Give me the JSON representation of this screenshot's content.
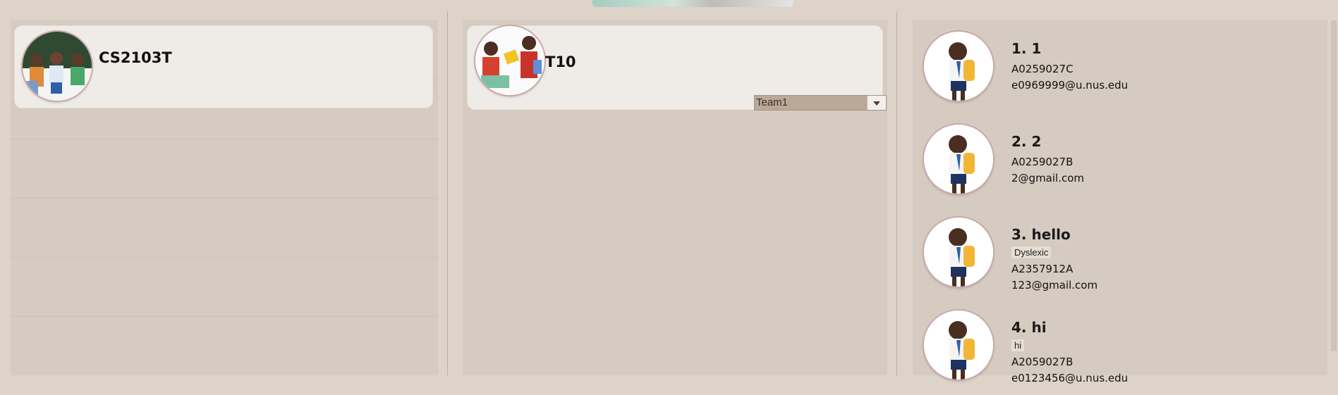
{
  "modules": {
    "items": [
      {
        "code": "CS2103T"
      }
    ]
  },
  "teams": {
    "items": [
      {
        "name": "T10",
        "selected_team": "Team1"
      }
    ]
  },
  "students": {
    "items": [
      {
        "header": "1.  1",
        "tag": "",
        "matric": "A0259027C",
        "email": "e0969999@u.nus.edu"
      },
      {
        "header": "2.  2",
        "tag": "",
        "matric": "A0259027B",
        "email": "2@gmail.com"
      },
      {
        "header": "3.  hello",
        "tag": "Dyslexic",
        "matric": "A2357912A",
        "email": "123@gmail.com"
      },
      {
        "header": "4.  hi",
        "tag": "hi",
        "matric": "A2059027B",
        "email": "e0123456@u.nus.edu"
      }
    ]
  },
  "icons": {
    "module_avatar": "teachers-class-avatar",
    "team_avatar": "team-students-avatar",
    "student_avatar": "student-with-backpack-avatar",
    "dropdown": "chevron-down-icon"
  },
  "colors": {
    "background": "#ddd3c8",
    "panel": "#d6cbc0",
    "card": "#efebe6",
    "select": "#baa998"
  }
}
